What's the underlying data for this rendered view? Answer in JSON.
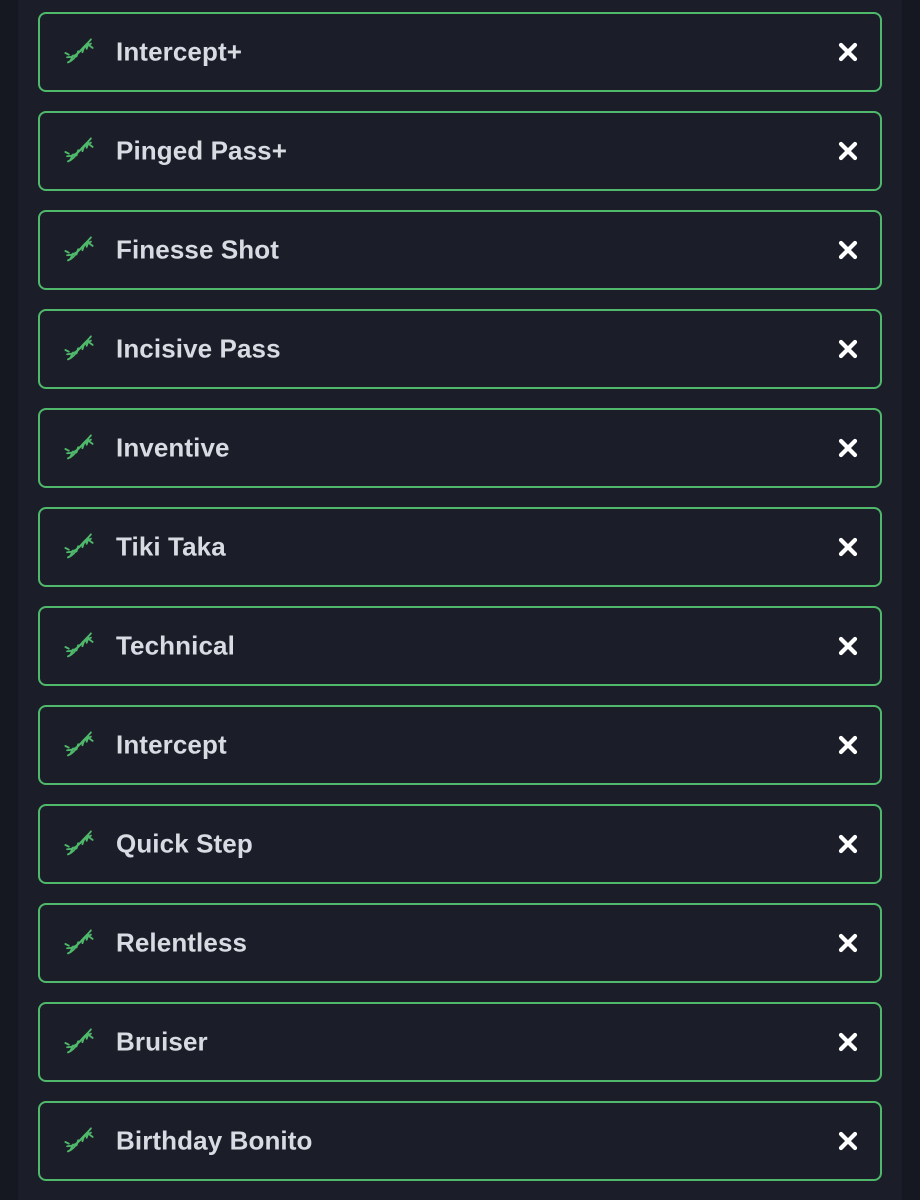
{
  "colors": {
    "background": "#151821",
    "panel": "#1b1e28",
    "accent": "#4fb86b",
    "text": "#d9dbe3",
    "remove_icon": "#ffffff"
  },
  "items": [
    {
      "label": "Intercept+",
      "icon": "dna-icon",
      "action_icon": "close-icon"
    },
    {
      "label": "Pinged Pass+",
      "icon": "dna-icon",
      "action_icon": "close-icon"
    },
    {
      "label": "Finesse Shot",
      "icon": "dna-icon",
      "action_icon": "close-icon"
    },
    {
      "label": "Incisive Pass",
      "icon": "dna-icon",
      "action_icon": "close-icon"
    },
    {
      "label": "Inventive",
      "icon": "dna-icon",
      "action_icon": "close-icon"
    },
    {
      "label": "Tiki Taka",
      "icon": "dna-icon",
      "action_icon": "close-icon"
    },
    {
      "label": "Technical",
      "icon": "dna-icon",
      "action_icon": "close-icon"
    },
    {
      "label": "Intercept",
      "icon": "dna-icon",
      "action_icon": "close-icon"
    },
    {
      "label": "Quick Step",
      "icon": "dna-icon",
      "action_icon": "close-icon"
    },
    {
      "label": "Relentless",
      "icon": "dna-icon",
      "action_icon": "close-icon"
    },
    {
      "label": "Bruiser",
      "icon": "dna-icon",
      "action_icon": "close-icon"
    },
    {
      "label": "Birthday Bonito",
      "icon": "dna-icon",
      "action_icon": "close-icon"
    }
  ]
}
